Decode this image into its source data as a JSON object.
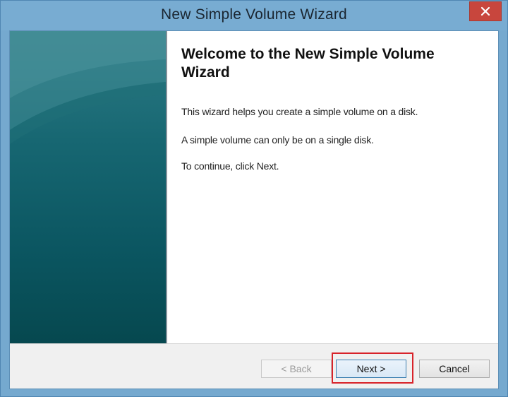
{
  "window": {
    "title": "New Simple Volume Wizard",
    "close_icon": "close-icon"
  },
  "banner": {
    "colors": [
      "#2e7c86",
      "#0b5661"
    ]
  },
  "content": {
    "heading": "Welcome to the New Simple Volume Wizard",
    "paragraphs": [
      "This wizard helps you create a simple volume on a disk.",
      "A simple volume can only be on a single disk.",
      "To continue, click Next."
    ]
  },
  "buttons": {
    "back": "< Back",
    "next": "Next >",
    "cancel": "Cancel"
  },
  "accents": {
    "highlight": "#d8232a",
    "close": "#c8463d"
  }
}
